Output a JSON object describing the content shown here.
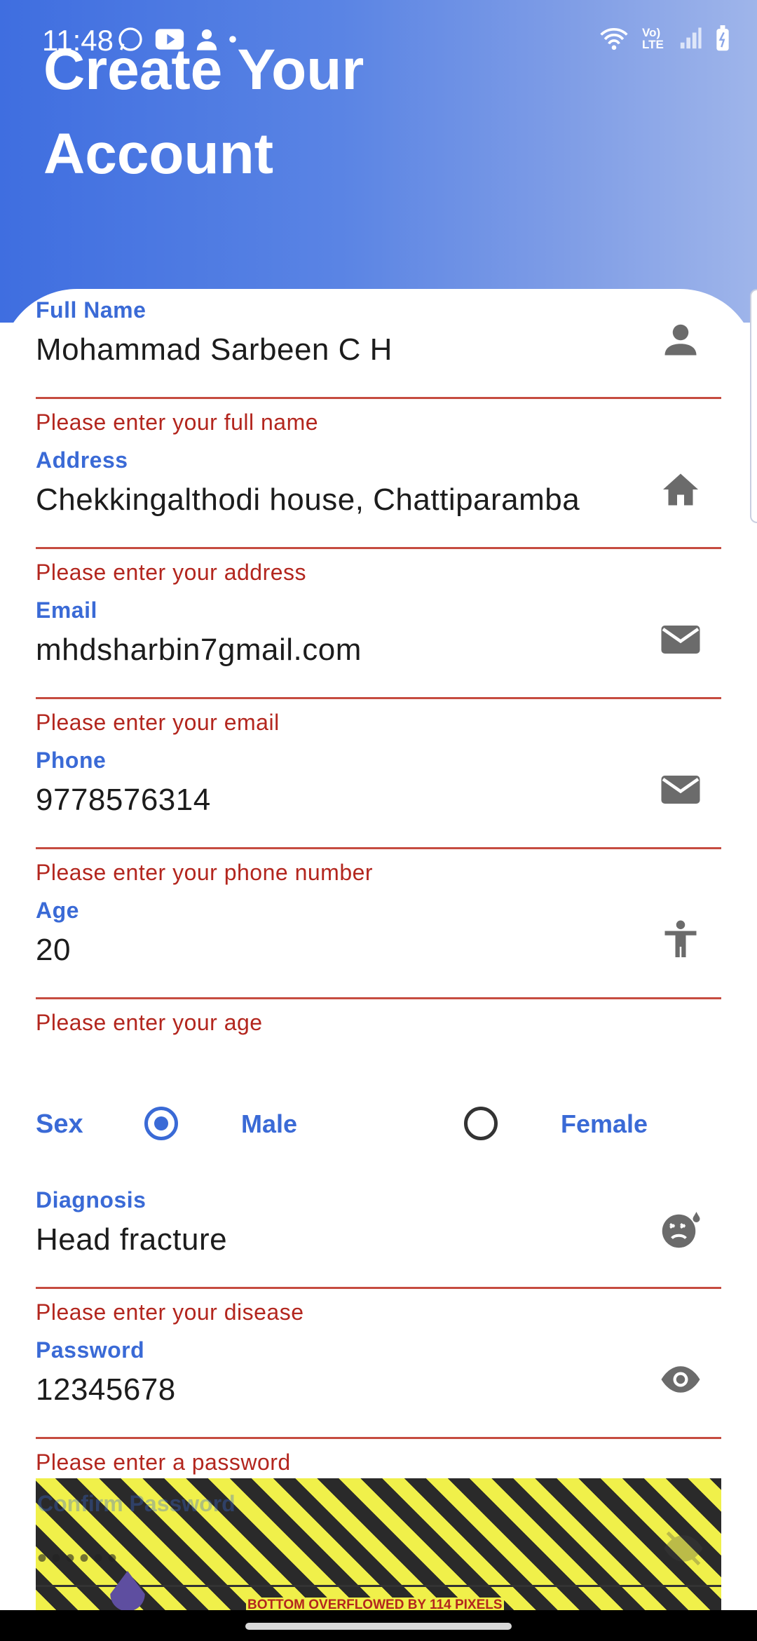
{
  "status_bar": {
    "time": "11:48",
    "left_icons": [
      "whatsapp-icon",
      "youtube-icon",
      "person-icon",
      "dot-icon"
    ],
    "right_icons": [
      "wifi-icon",
      "volte-icon",
      "signal-icon",
      "battery-icon"
    ],
    "volte_label": "Vo) LTE"
  },
  "header": {
    "title_line1": "Create Your",
    "title_line2": "Account"
  },
  "form": {
    "full_name": {
      "label": "Full Name",
      "value": "Mohammad Sarbeen C H",
      "icon": "person-icon",
      "error": "Please enter your full name"
    },
    "address": {
      "label": "Address",
      "value": "Chekkingalthodi house, Chattiparamba",
      "icon": "home-icon",
      "error": "Please enter your address"
    },
    "email": {
      "label": "Email",
      "value": "mhdsharbin7gmail.com",
      "icon": "mail-icon",
      "error": "Please enter your email"
    },
    "phone": {
      "label": "Phone",
      "value": "9778576314",
      "icon": "mail-icon",
      "error": "Please enter your phone number"
    },
    "age": {
      "label": "Age",
      "value": "20",
      "icon": "accessibility-icon",
      "error": "Please enter your age"
    },
    "sex": {
      "label": "Sex",
      "options": [
        "Male",
        "Female"
      ],
      "selected": "Male"
    },
    "diagnosis": {
      "label": "Diagnosis",
      "value": "Head fracture",
      "icon": "sick-face-icon",
      "error": "Please enter your disease"
    },
    "password": {
      "label": "Password",
      "value": "12345678",
      "icon": "eye-icon",
      "error": "Please enter a password"
    },
    "confirm_password": {
      "label": "Confirm Password",
      "value": "••••••",
      "icon": "eye-off-icon"
    }
  },
  "overflow_banner": "BOTTOM OVERFLOWED BY 114 PIXELS",
  "colors": {
    "accent": "#3a6ad6",
    "error": "#b3261e",
    "gradient_start": "#3f6ee0",
    "gradient_end": "#9fb5ea"
  }
}
